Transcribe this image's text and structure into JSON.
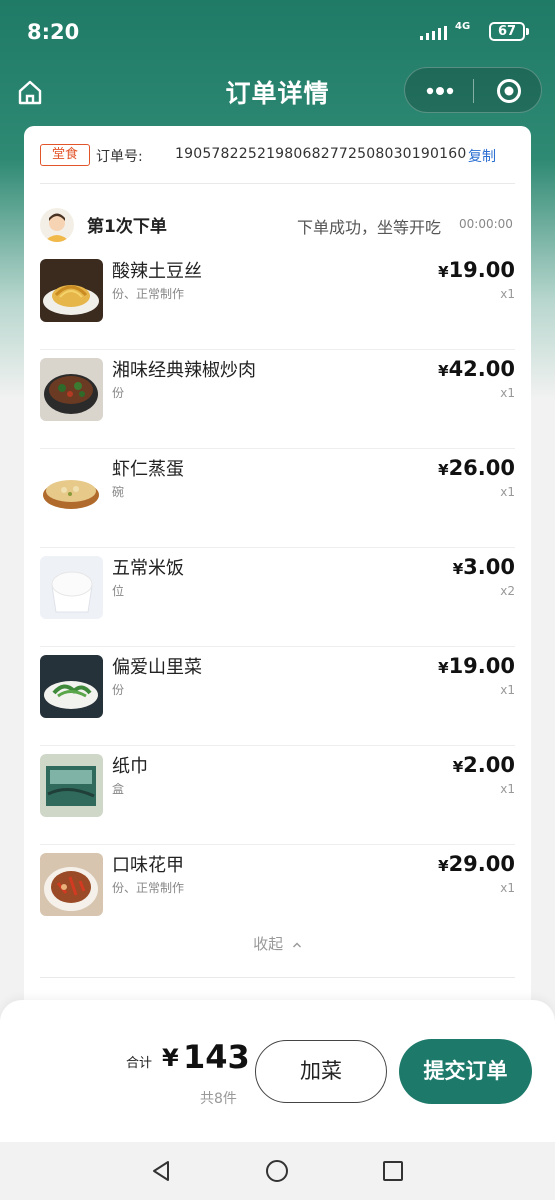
{
  "status_bar": {
    "time": "8:20",
    "network": "4G",
    "battery": "67"
  },
  "nav": {
    "title": "订单详情",
    "icons": [
      "home-icon",
      "more-icon",
      "target-icon"
    ]
  },
  "order": {
    "tag": "堂食",
    "label": "订单号:",
    "number": "19057822521980682772508030190160",
    "copy": "复制"
  },
  "batch": {
    "title": "第1次下单",
    "status": "下单成功，坐等开吃",
    "time": "00:00:00"
  },
  "items": [
    {
      "name": "酸辣土豆丝",
      "spec": "份、正常制作",
      "price": "19.00",
      "qty": "x1"
    },
    {
      "name": "湘味经典辣椒炒肉",
      "spec": "份",
      "price": "42.00",
      "qty": "x1"
    },
    {
      "name": "虾仁蒸蛋",
      "spec": "碗",
      "price": "26.00",
      "qty": "x1"
    },
    {
      "name": "五常米饭",
      "spec": "位",
      "price": "3.00",
      "qty": "x2"
    },
    {
      "name": "偏爱山里菜",
      "spec": "份",
      "price": "19.00",
      "qty": "x1"
    },
    {
      "name": "纸巾",
      "spec": "盒",
      "price": "2.00",
      "qty": "x1"
    },
    {
      "name": "口味花甲",
      "spec": "份、正常制作",
      "price": "29.00",
      "qty": "x1"
    }
  ],
  "currency": "¥",
  "collapse_label": "收起",
  "footer": {
    "total_label": "合计",
    "currency": "¥",
    "total": "143",
    "count": "共8件",
    "add_label": "加菜",
    "submit_label": "提交订单"
  },
  "colors": {
    "brand": "#1d7a6b",
    "tag": "#e2552a",
    "link": "#2c6fd1"
  }
}
